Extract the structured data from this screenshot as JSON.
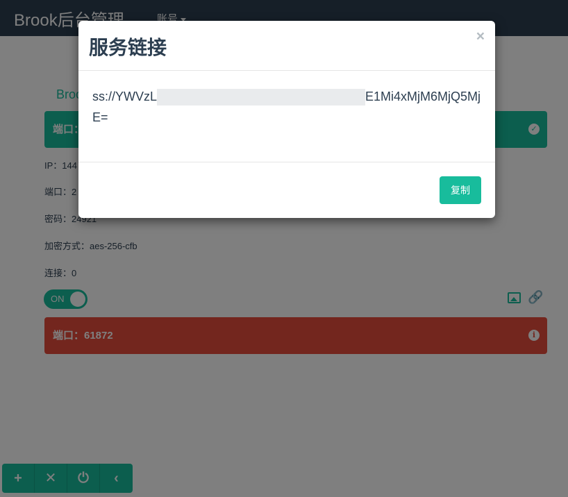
{
  "navbar": {
    "brand": "Brook后台管理",
    "account_menu": "账号"
  },
  "page": {
    "section_title": "Broo",
    "server_card": {
      "header_label": "端口：",
      "icon": "check-circle-icon"
    },
    "info": {
      "ip": "IP：144",
      "port": "端口：2",
      "password": "密码：24921",
      "encryption": "加密方式：aes-256-cfb",
      "connections": "连接：0"
    },
    "toggle_label": "ON",
    "server_card_2": {
      "header_label": "端口：61872",
      "icon": "info-circle-icon"
    },
    "bottom_toolbar": [
      "+",
      "✕",
      "⏻",
      "‹"
    ]
  },
  "modal": {
    "title": "服务链接",
    "close": "×",
    "link_prefix": "ss://YWVzL",
    "link_suffix": "E1Mi4xMjM6MjQ5MjE=",
    "copy_button": "复制"
  },
  "colors": {
    "navbar": "#2c3e50",
    "accent": "#18bc9c",
    "danger": "#e74c3c"
  }
}
